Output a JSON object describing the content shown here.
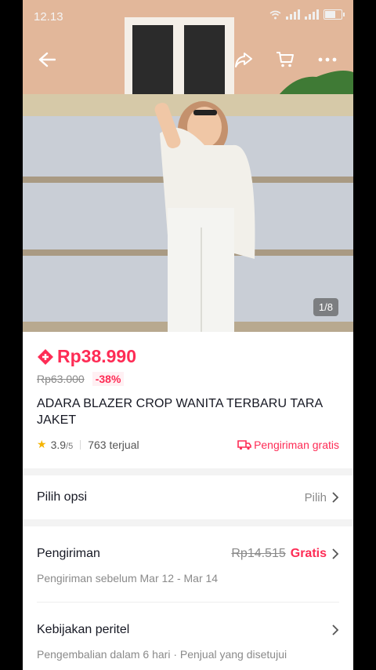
{
  "status": {
    "time": "12.13"
  },
  "image": {
    "counter": "1/8"
  },
  "product": {
    "price": "Rp38.990",
    "old_price": "Rp63.000",
    "discount": "-38%",
    "title": "ADARA BLAZER CROP WANITA TERBARU TARA JAKET",
    "rating": "3.9",
    "rating_max": "/5",
    "sold": "763 terjual",
    "free_shipping": "Pengiriman gratis"
  },
  "options": {
    "label": "Pilih opsi",
    "action": "Pilih"
  },
  "shipping": {
    "label": "Pengiriman",
    "old_fee": "Rp14.515",
    "fee": "Gratis",
    "estimate": "Pengiriman sebelum Mar 12 - Mar 14"
  },
  "policy": {
    "label": "Kebijakan peritel",
    "detail": "Pengembalian dalam 6 hari · Penjual yang disetujui"
  },
  "colors": {
    "accent": "#fe2c55",
    "rating_star": "#f5b400"
  }
}
